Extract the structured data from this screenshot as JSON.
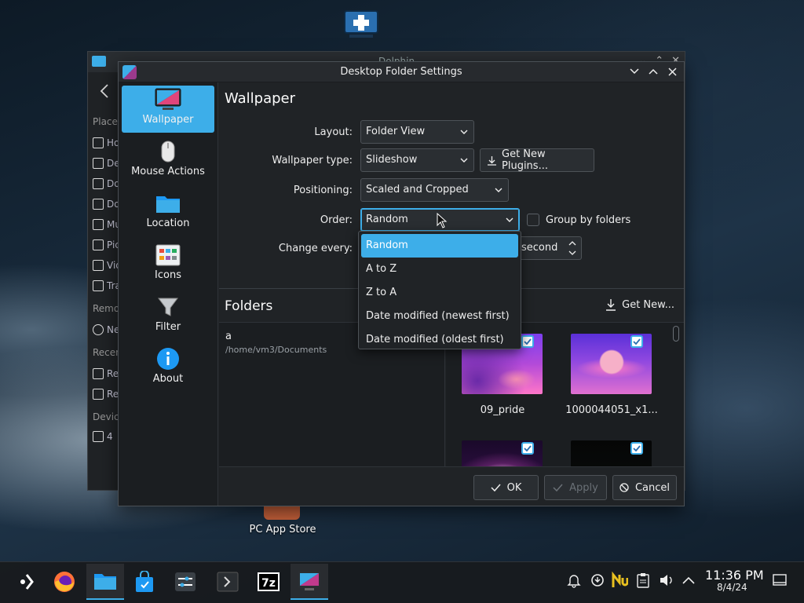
{
  "desktop": {
    "app_store_label": "PC App Store"
  },
  "dolphin": {
    "title": "Dolphin",
    "places_header": "Places",
    "places": [
      "Home",
      "Desktop",
      "Documents",
      "Downloads",
      "Music",
      "Pictures",
      "Videos",
      "Trash"
    ],
    "remote_header": "Remote",
    "remote": [
      "Network"
    ],
    "recent_header": "Recent",
    "recent": [
      "Recent Files",
      "Recent Locations"
    ],
    "devices_header": "Devices",
    "devices": [
      "4"
    ]
  },
  "dialog": {
    "title": "Desktop Folder Settings",
    "nav": [
      {
        "label": "Wallpaper",
        "icon": "monitor-icon",
        "active": true
      },
      {
        "label": "Mouse Actions",
        "icon": "mouse-icon",
        "active": false
      },
      {
        "label": "Location",
        "icon": "folder-icon",
        "active": false
      },
      {
        "label": "Icons",
        "icon": "icons-grid-icon",
        "active": false
      },
      {
        "label": "Filter",
        "icon": "filter-icon",
        "active": false
      },
      {
        "label": "About",
        "icon": "info-icon",
        "active": false
      }
    ],
    "page_title": "Wallpaper",
    "form": {
      "layout_label": "Layout:",
      "layout_value": "Folder View",
      "wallpaper_type_label": "Wallpaper type:",
      "wallpaper_type_value": "Slideshow",
      "get_plugins_label": "Get New Plugins...",
      "positioning_label": "Positioning:",
      "positioning_value": "Scaled and Cropped",
      "order_label": "Order:",
      "order_value": "Random",
      "group_by_folders_label": "Group by folders",
      "group_by_folders_checked": false,
      "change_every_label": "Change every:",
      "change_every_unit": "second"
    },
    "order_options": [
      "Random",
      "A to Z",
      "Z to A",
      "Date modified (newest first)",
      "Date modified (oldest first)"
    ],
    "order_selected_index": 0,
    "folders": {
      "title": "Folders",
      "get_new_label": "Get New...",
      "items": [
        {
          "name": "a",
          "path": "/home/vm3/Documents"
        }
      ]
    },
    "wallpapers": [
      {
        "label": "09_pride",
        "checked": true
      },
      {
        "label": "1000044051_x1...",
        "checked": true
      },
      {
        "label": "",
        "checked": true
      },
      {
        "label": "",
        "checked": true
      }
    ],
    "buttons": {
      "ok": "OK",
      "apply": "Apply",
      "cancel": "Cancel"
    }
  },
  "taskbar": {
    "time": "11:36 PM",
    "date": "8/4/24"
  },
  "colors": {
    "accent": "#3daee9",
    "window_bg": "#202326",
    "sidebar_bg": "#1b1e21"
  }
}
